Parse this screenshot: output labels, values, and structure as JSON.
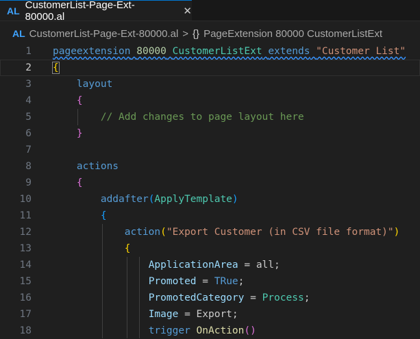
{
  "tab": {
    "lang_badge": "AL",
    "title": "CustomerList-Page-Ext-80000.al",
    "close_glyph": "✕"
  },
  "breadcrumb": {
    "lang_badge": "AL",
    "file": "CustomerList-Page-Ext-80000.al",
    "separator": ">",
    "symbol_glyph": "{}",
    "symbol": "PageExtension 80000 CustomerListExt"
  },
  "editor": {
    "active_line": 2,
    "lines": [
      {
        "n": "1",
        "tokens": [
          [
            "kw",
            "pageextension"
          ],
          [
            "pl",
            " "
          ],
          [
            "num",
            "80000"
          ],
          [
            "pl",
            " "
          ],
          [
            "ty",
            "CustomerListExt"
          ],
          [
            "pl",
            " "
          ],
          [
            "kw",
            "extends"
          ],
          [
            "pl",
            " "
          ],
          [
            "str",
            "\"Customer List\""
          ]
        ]
      },
      {
        "n": "2",
        "tokens": [
          [
            "b1",
            "{"
          ]
        ]
      },
      {
        "n": "3",
        "tokens": [
          [
            "pl",
            "    "
          ],
          [
            "kw",
            "layout"
          ]
        ]
      },
      {
        "n": "4",
        "tokens": [
          [
            "pl",
            "    "
          ],
          [
            "b2",
            "{"
          ]
        ]
      },
      {
        "n": "5",
        "tokens": [
          [
            "pl",
            "        "
          ],
          [
            "cmt",
            "// Add changes to page layout here"
          ]
        ]
      },
      {
        "n": "6",
        "tokens": [
          [
            "pl",
            "    "
          ],
          [
            "b2",
            "}"
          ]
        ]
      },
      {
        "n": "7",
        "tokens": []
      },
      {
        "n": "8",
        "tokens": [
          [
            "pl",
            "    "
          ],
          [
            "kw",
            "actions"
          ]
        ]
      },
      {
        "n": "9",
        "tokens": [
          [
            "pl",
            "    "
          ],
          [
            "b2",
            "{"
          ]
        ]
      },
      {
        "n": "10",
        "tokens": [
          [
            "pl",
            "        "
          ],
          [
            "kw",
            "addafter"
          ],
          [
            "b3",
            "("
          ],
          [
            "ty",
            "ApplyTemplate"
          ],
          [
            "b3",
            ")"
          ]
        ]
      },
      {
        "n": "11",
        "tokens": [
          [
            "pl",
            "        "
          ],
          [
            "b3",
            "{"
          ]
        ]
      },
      {
        "n": "12",
        "tokens": [
          [
            "pl",
            "            "
          ],
          [
            "kw",
            "action"
          ],
          [
            "b1",
            "("
          ],
          [
            "str",
            "\"Export Customer (in CSV file format)\""
          ],
          [
            "b1",
            ")"
          ]
        ]
      },
      {
        "n": "13",
        "tokens": [
          [
            "pl",
            "            "
          ],
          [
            "b1",
            "{"
          ]
        ]
      },
      {
        "n": "14",
        "tokens": [
          [
            "pl",
            "                "
          ],
          [
            "var",
            "ApplicationArea"
          ],
          [
            "pl",
            " = all;"
          ]
        ]
      },
      {
        "n": "15",
        "tokens": [
          [
            "pl",
            "                "
          ],
          [
            "var",
            "Promoted"
          ],
          [
            "pl",
            " = "
          ],
          [
            "kw",
            "TRue"
          ],
          [
            "pl",
            ";"
          ]
        ]
      },
      {
        "n": "16",
        "tokens": [
          [
            "pl",
            "                "
          ],
          [
            "var",
            "PromotedCategory"
          ],
          [
            "pl",
            " = "
          ],
          [
            "ty",
            "Process"
          ],
          [
            "pl",
            ";"
          ]
        ]
      },
      {
        "n": "17",
        "tokens": [
          [
            "pl",
            "                "
          ],
          [
            "var",
            "Image"
          ],
          [
            "pl",
            " = Export;"
          ]
        ]
      },
      {
        "n": "18",
        "tokens": [
          [
            "pl",
            "                "
          ],
          [
            "kw",
            "trigger"
          ],
          [
            "pl",
            " "
          ],
          [
            "fn",
            "OnAction"
          ],
          [
            "b2",
            "()"
          ]
        ]
      }
    ]
  },
  "colors": {
    "background": "#1f1f1f",
    "keyword": "#569cd6",
    "string": "#ce9178",
    "type": "#4ec9b0",
    "comment": "#6a9955",
    "number": "#b5cea8",
    "variable": "#9cdcfe",
    "function": "#dcdcaa",
    "accent": "#0078d4"
  }
}
